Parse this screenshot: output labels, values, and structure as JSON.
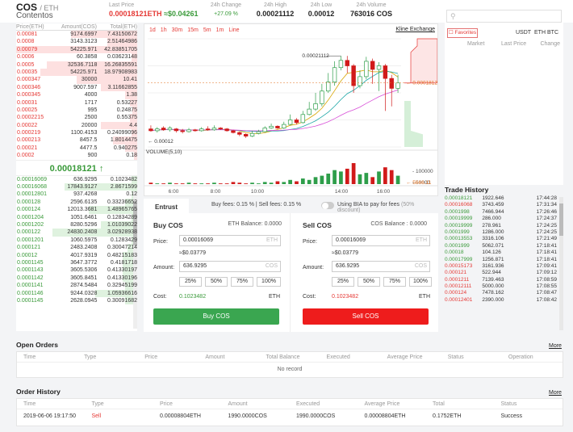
{
  "header": {
    "base": "COS",
    "quote": "/ ETH",
    "name": "Contentos",
    "last_price_label": "Last Price",
    "last_price": "0.00018121ETH",
    "last_price_usd": "≈$0.04261",
    "change_label": "24h Change",
    "change": "+27.09 %",
    "high_label": "24h High",
    "high": "0.00021112",
    "low_label": "24h Low",
    "low": "0.00012",
    "volume_label": "24h Volume",
    "volume": "763016 COS"
  },
  "orderbook": {
    "headers": [
      "Price(ETH)",
      "Amount(COS)",
      "Total(ETH)"
    ],
    "asks": [
      {
        "p": "0.00081",
        "a": "9174.6997",
        "t": "7.43150672",
        "w": 0.55
      },
      {
        "p": "0.0008",
        "a": "3143.3123",
        "t": "2.51464986",
        "w": 0.25
      },
      {
        "p": "0.00079",
        "a": "54225.971",
        "t": "42.83851705",
        "w": 1.0
      },
      {
        "p": "0.0006",
        "a": "60.3858",
        "t": "0.03623148",
        "w": 0.05
      },
      {
        "p": "0.0005",
        "a": "32536.7118",
        "t": "16.26835591",
        "w": 0.75
      },
      {
        "p": "0.00035",
        "a": "54225.971",
        "t": "18.97908983",
        "w": 0.8
      },
      {
        "p": "0.000347",
        "a": "30000",
        "t": "10.41",
        "w": 0.5
      },
      {
        "p": "0.000346",
        "a": "9007.597",
        "t": "3.11662855",
        "w": 0.3
      },
      {
        "p": "0.000345",
        "a": "4000",
        "t": "1.38",
        "w": 0.1
      },
      {
        "p": "0.00031",
        "a": "1717",
        "t": "0.53227",
        "w": 0.06
      },
      {
        "p": "0.00025",
        "a": "995",
        "t": "0.24875",
        "w": 0.04
      },
      {
        "p": "0.0002215",
        "a": "2500",
        "t": "0.55375",
        "w": 0.06
      },
      {
        "p": "0.00022",
        "a": "20000",
        "t": "4.4",
        "w": 0.3
      },
      {
        "p": "0.000219",
        "a": "1100.4153",
        "t": "0.24099096",
        "w": 0.05
      },
      {
        "p": "0.000213",
        "a": "8457.5",
        "t": "1.8014475",
        "w": 0.2
      },
      {
        "p": "0.00021",
        "a": "4477.5",
        "t": "0.940275",
        "w": 0.1
      },
      {
        "p": "0.0002",
        "a": "900",
        "t": "0.18",
        "w": 0.03
      }
    ],
    "mid_price": "0.00018121",
    "mid_arrow": "↑",
    "bids": [
      {
        "p": "0.00016069",
        "a": "636.9295",
        "t": "0.1023482",
        "w": 0.05
      },
      {
        "p": "0.00016068",
        "a": "17843.9127",
        "t": "2.8671599",
        "w": 0.6
      },
      {
        "p": "0.00012801",
        "a": "937.4268",
        "t": "0.12",
        "w": 0.05
      },
      {
        "p": "0.000128",
        "a": "2596.6135",
        "t": "0.33236652",
        "w": 0.1
      },
      {
        "p": "0.000124",
        "a": "12013.3681",
        "t": "1.48965765",
        "w": 0.4
      },
      {
        "p": "0.0001204",
        "a": "1051.6461",
        "t": "0.12834289",
        "w": 0.05
      },
      {
        "p": "0.0001202",
        "a": "8280.5296",
        "t": "1.01039022",
        "w": 0.3
      },
      {
        "p": "0.000122",
        "a": "24830.2408",
        "t": "3.02928938",
        "w": 0.7
      },
      {
        "p": "0.0001201",
        "a": "1060.5975",
        "t": "0.1283429",
        "w": 0.05
      },
      {
        "p": "0.000121",
        "a": "2483.2408",
        "t": "0.30047214",
        "w": 0.08
      },
      {
        "p": "0.00012",
        "a": "4017.9319",
        "t": "0.48215183",
        "w": 0.12
      },
      {
        "p": "0.0001145",
        "a": "3647.3772",
        "t": "0.4181718",
        "w": 0.12
      },
      {
        "p": "0.0001143",
        "a": "3605.5306",
        "t": "0.41330197",
        "w": 0.12
      },
      {
        "p": "0.0001142",
        "a": "3605.8451",
        "t": "0.41330196",
        "w": 0.12
      },
      {
        "p": "0.0001141",
        "a": "2874.5484",
        "t": "0.32945199",
        "w": 0.1
      },
      {
        "p": "0.0001146",
        "a": "9244.0328",
        "t": "1.05936616",
        "w": 0.35
      },
      {
        "p": "0.0001145",
        "a": "2628.0945",
        "t": "0.30091682",
        "w": 0.1
      }
    ]
  },
  "chart": {
    "timeframes": [
      "1m",
      "1d",
      "1h",
      "30m",
      "15m",
      "5m",
      "1m",
      "Line"
    ],
    "kline_link": "Kline Exchange",
    "max_label": "0.00021112",
    "min_label": "0.00012",
    "current_label": "0.00018121",
    "volume_label": "VOLUME(5,10)",
    "vol_ticks": [
      "100000",
      "50000"
    ],
    "vol_cur": "5666.11",
    "x_ticks": [
      "6:00",
      "8:00",
      "10:00",
      "14:00",
      "16:00"
    ]
  },
  "chart_data": {
    "type": "candlestick",
    "y_range": [
      0.00011,
      0.00023
    ],
    "candles": [
      [
        0.00013,
        0.000128,
        0.000134,
        0.000127
      ],
      [
        0.000128,
        0.00013,
        0.000132,
        0.000126
      ],
      [
        0.000131,
        0.000129,
        0.000133,
        0.000128
      ],
      [
        0.000129,
        0.000131,
        0.000133,
        0.000127
      ],
      [
        0.00013,
        0.000128,
        0.000131,
        0.000126
      ],
      [
        0.000128,
        0.000127,
        0.00013,
        0.000125
      ],
      [
        0.000127,
        0.000129,
        0.000131,
        0.000126
      ],
      [
        0.000129,
        0.000128,
        0.00013,
        0.000127
      ],
      [
        0.000128,
        0.00013,
        0.000132,
        0.000127
      ],
      [
        0.00013,
        0.000129,
        0.000133,
        0.000128
      ],
      [
        0.000129,
        0.000131,
        0.000134,
        0.000128
      ],
      [
        0.000131,
        0.00013,
        0.000132,
        0.000129
      ],
      [
        0.00013,
        0.000128,
        0.000131,
        0.000127
      ],
      [
        0.000128,
        0.000126,
        0.000129,
        0.000125
      ],
      [
        0.000126,
        0.000124,
        0.000127,
        0.000122
      ],
      [
        0.000124,
        0.000122,
        0.000125,
        0.00012
      ],
      [
        0.000122,
        0.000125,
        0.000128,
        0.000121
      ],
      [
        0.000125,
        0.000127,
        0.000129,
        0.000124
      ],
      [
        0.000127,
        0.000131,
        0.000133,
        0.000126
      ],
      [
        0.000131,
        0.000133,
        0.000136,
        0.00013
      ],
      [
        0.000133,
        0.000131,
        0.000134,
        0.00013
      ],
      [
        0.000131,
        0.000135,
        0.000138,
        0.00013
      ],
      [
        0.000135,
        0.00014,
        0.000146,
        0.000134
      ],
      [
        0.00014,
        0.000137,
        0.000142,
        0.000135
      ],
      [
        0.000137,
        0.000146,
        0.00015,
        0.000136
      ],
      [
        0.000146,
        0.000152,
        0.00016,
        0.000145
      ],
      [
        0.000152,
        0.000158,
        0.00017,
        0.00015
      ],
      [
        0.000158,
        0.000172,
        0.00018,
        0.000155
      ],
      [
        0.000172,
        0.000182,
        0.000192,
        0.00017
      ],
      [
        0.000182,
        0.000198,
        0.000205,
        0.000178
      ],
      [
        0.000198,
        0.000206,
        0.000211,
        0.000195
      ],
      [
        0.000206,
        0.0002,
        0.000211,
        0.000192
      ],
      [
        0.0002,
        0.000178,
        0.000202,
        0.00017
      ],
      [
        0.000178,
        0.000188,
        0.000195,
        0.000175
      ],
      [
        0.000188,
        0.000205,
        0.00021,
        0.000185
      ],
      [
        0.000205,
        0.000196,
        0.000208,
        0.00018
      ],
      [
        0.000196,
        0.0002,
        0.000204,
        0.000172
      ],
      [
        0.0002,
        0.000186,
        0.000202,
        0.00015
      ],
      [
        0.000186,
        0.000175,
        0.00019,
        0.000155
      ],
      [
        0.000175,
        0.000181,
        0.00019,
        0.00017
      ]
    ],
    "volumes": [
      2,
      1,
      1,
      2,
      1,
      1,
      2,
      1,
      1,
      1,
      2,
      1,
      1,
      3,
      2,
      1,
      2,
      1,
      3,
      2,
      4,
      3,
      6,
      4,
      8,
      6,
      10,
      12,
      15,
      20,
      18,
      22,
      30,
      14,
      16,
      10,
      18,
      24,
      20,
      12
    ]
  },
  "entrust": {
    "tab": "Entrust",
    "fees": "Buy fees:  0.15 % | Sell fees:  0.15 %",
    "bia_label": "Using BIA to pay for fees",
    "bia_discount": "(50% discount)",
    "buy": {
      "title": "Buy COS",
      "balance": "ETH Balance: 0.0000",
      "price_label": "Price:",
      "price": "0.00016069",
      "price_unit": "ETH",
      "approx": "≈$0.03779",
      "amount_label": "Amount:",
      "amount": "636.9295",
      "amount_unit": "COS",
      "pcts": [
        "25%",
        "50%",
        "75%",
        "100%"
      ],
      "cost_label": "Cost:",
      "cost": "0.1023482",
      "cost_unit": "ETH",
      "button": "Buy COS"
    },
    "sell": {
      "title": "Sell COS",
      "balance": "COS Balance : 0.0000",
      "price_label": "Price:",
      "price": "0.00016069",
      "price_unit": "ETH",
      "approx": "≈$0.03779",
      "amount_label": "Amount:",
      "amount": "636.9295",
      "amount_unit": "COS",
      "pcts": [
        "25%",
        "50%",
        "75%",
        "100%"
      ],
      "cost_label": "Cost:",
      "cost": "0.1023482",
      "cost_unit": "ETH",
      "button": "Sell COS"
    }
  },
  "market": {
    "favorites": "☐ Favorites",
    "tabs": [
      "USDT",
      "ETH",
      "BTC"
    ],
    "cols": [
      "Market",
      "Last Price",
      "Change"
    ]
  },
  "trade_history": {
    "title": "Trade History",
    "rows": [
      {
        "p": "0.00018121",
        "a": "1922.646",
        "t": "17:44:28",
        "c": "g"
      },
      {
        "p": "0.00016068",
        "a": "3743.459",
        "t": "17:31:34",
        "c": "r"
      },
      {
        "p": "0.0001998",
        "a": "7466.944",
        "t": "17:26:46",
        "c": "g"
      },
      {
        "p": "0.00019999",
        "a": "286.000",
        "t": "17:24:37",
        "c": "g"
      },
      {
        "p": "0.00019999",
        "a": "278.961",
        "t": "17:24:25",
        "c": "g"
      },
      {
        "p": "0.0001999",
        "a": "1286.000",
        "t": "17:24:25",
        "c": "g"
      },
      {
        "p": "0.00013553",
        "a": "3316.106",
        "t": "17:21:49",
        "c": "g"
      },
      {
        "p": "0.0001999",
        "a": "5062.071",
        "t": "17:18:41",
        "c": "g"
      },
      {
        "p": "0.00018",
        "a": "104.126",
        "t": "17:18:41",
        "c": "g"
      },
      {
        "p": "0.00017999",
        "a": "1256.871",
        "t": "17:18:41",
        "c": "g"
      },
      {
        "p": "0.00015173",
        "a": "3161.936",
        "t": "17:09:41",
        "c": "r"
      },
      {
        "p": "0.000121",
        "a": "522.944",
        "t": "17:09:12",
        "c": "r"
      },
      {
        "p": "0.0001211",
        "a": "7139.463",
        "t": "17:08:59",
        "c": "r"
      },
      {
        "p": "0.00012111",
        "a": "5000.000",
        "t": "17:08:55",
        "c": "r"
      },
      {
        "p": "0.000124",
        "a": "7478.162",
        "t": "17:08:47",
        "c": "r"
      },
      {
        "p": "0.00012401",
        "a": "2390.000",
        "t": "17:08:42",
        "c": "r"
      }
    ]
  },
  "open_orders": {
    "title": "Open Orders",
    "more": "More",
    "cols": [
      "Time",
      "Type",
      "Price",
      "Amount",
      "Total Balance",
      "Executed",
      "Average Price",
      "Status",
      "Operation"
    ],
    "empty": "No record"
  },
  "order_history": {
    "title": "Order History",
    "more": "More",
    "cols": [
      "Time",
      "Type",
      "Price",
      "Amount",
      "Executed",
      "Average Price",
      "Total",
      "Status"
    ],
    "rows": [
      [
        "2019-06-06 19:17:50",
        "Sell",
        "0.00008804ETH",
        "1990.0000COS",
        "1990.0000COS",
        "0.00008804ETH",
        "0.1752ETH",
        "Success"
      ]
    ]
  }
}
